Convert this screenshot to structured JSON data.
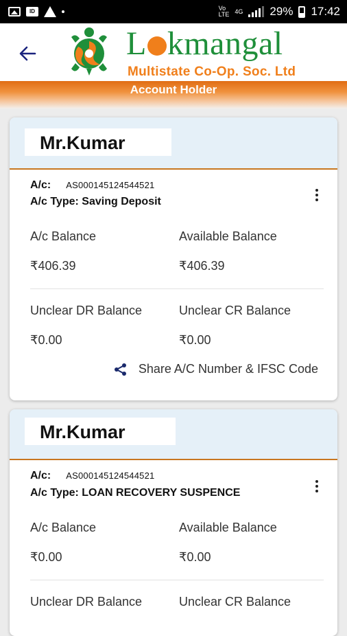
{
  "status_bar": {
    "network_label": "4G",
    "battery": "29%",
    "time": "17:42"
  },
  "header": {
    "brand_name_part1": "L",
    "brand_name_part2": "kmangal",
    "brand_subtitle": "Multistate Co-Op. Soc. Ltd",
    "section_title": "Account Holder"
  },
  "accounts": [
    {
      "holder_name": "Mr.Kumar",
      "ac_label": "A/c:",
      "ac_number": "AS000145124544521",
      "ac_type_label": "A/c Type:",
      "ac_type": "Saving Deposit",
      "ac_balance_label": "A/c Balance",
      "ac_balance": "₹406.39",
      "available_balance_label": "Available Balance",
      "available_balance": "₹406.39",
      "unclear_dr_label": "Unclear DR Balance",
      "unclear_dr": "₹0.00",
      "unclear_cr_label": "Unclear CR Balance",
      "unclear_cr": "₹0.00",
      "share_label": "Share A/C Number & IFSC Code"
    },
    {
      "holder_name": "Mr.Kumar",
      "ac_label": "A/c:",
      "ac_number": "AS000145124544521",
      "ac_type_label": "A/c Type:",
      "ac_type": "LOAN RECOVERY SUSPENCE",
      "ac_balance_label": "A/c Balance",
      "ac_balance": "₹0.00",
      "available_balance_label": "Available Balance",
      "available_balance": "₹0.00",
      "unclear_dr_label": "Unclear DR Balance",
      "unclear_cr_label": "Unclear CR Balance"
    }
  ],
  "colors": {
    "brand_green": "#1f8f3a",
    "brand_orange": "#f07f1b",
    "card_header_bg": "#e5f0f8",
    "back_arrow": "#1a237e"
  },
  "icons": [
    "back-arrow-icon",
    "share-icon",
    "more-vert-icon",
    "lokmangal-logo-icon"
  ]
}
